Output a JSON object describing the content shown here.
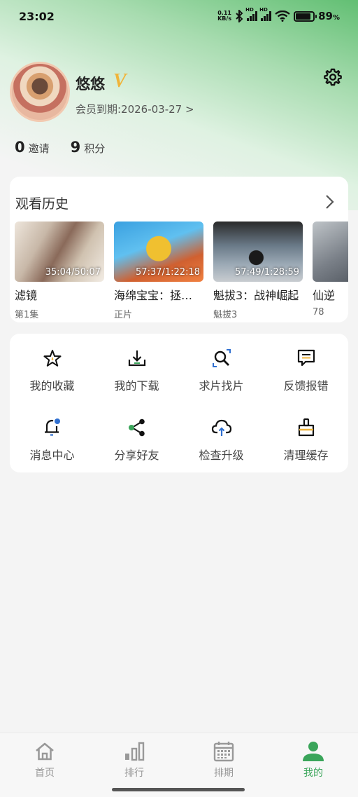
{
  "status_bar": {
    "time": "23:02",
    "net_speed_value": "0.11",
    "net_speed_unit": "KB/s",
    "battery_percent": "89",
    "battery_symbol": "%",
    "battery_level": 0.89,
    "sim1_label": "HD",
    "sim2_label": "HD"
  },
  "profile": {
    "username": "悠悠",
    "vip_badge": "V",
    "member_expire": "会员到期:2026-03-27 >"
  },
  "stats": {
    "invite_count": "0",
    "invite_label": "邀请",
    "points_count": "9",
    "points_label": "积分"
  },
  "history": {
    "title": "观看历史",
    "items": [
      {
        "title": "滤镜",
        "subtitle": "第1集",
        "time": "35:04/50:07"
      },
      {
        "title": "海绵宝宝：拯…",
        "subtitle": "正片",
        "time": "57:37/1:22:18"
      },
      {
        "title": "魁拔3：战神崛起",
        "subtitle": "魁拔3",
        "time": "57:49/1:28:59"
      },
      {
        "title": "仙逆",
        "subtitle": "78",
        "time": ""
      }
    ]
  },
  "menu": {
    "items": [
      {
        "label": "我的收藏",
        "icon": "star-icon"
      },
      {
        "label": "我的下载",
        "icon": "download-icon"
      },
      {
        "label": "求片找片",
        "icon": "search-icon"
      },
      {
        "label": "反馈报错",
        "icon": "feedback-icon"
      },
      {
        "label": "消息中心",
        "icon": "bell-icon"
      },
      {
        "label": "分享好友",
        "icon": "share-icon"
      },
      {
        "label": "检查升级",
        "icon": "cloud-upload-icon"
      },
      {
        "label": "清理缓存",
        "icon": "broom-icon"
      }
    ]
  },
  "tab_bar": {
    "tabs": [
      {
        "label": "首页",
        "icon": "home-icon"
      },
      {
        "label": "排行",
        "icon": "rank-icon"
      },
      {
        "label": "排期",
        "icon": "calendar-icon"
      },
      {
        "label": "我的",
        "icon": "user-icon",
        "active": true
      }
    ]
  },
  "colors": {
    "accent": "#3aa55a",
    "vip_gold": "#f0b43a",
    "icon_blue": "#2f6fd0"
  }
}
